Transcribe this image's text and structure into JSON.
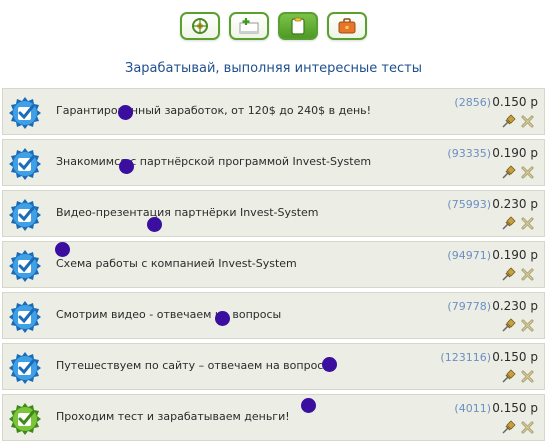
{
  "toolbar": {
    "buttons": [
      {
        "icon": "target-icon",
        "active": false
      },
      {
        "icon": "add-window-icon",
        "active": false
      },
      {
        "icon": "clipboard-icon",
        "active": true
      },
      {
        "icon": "briefcase-icon",
        "active": false
      }
    ]
  },
  "page_title": "Зарабатывай, выполняя интересные тесты",
  "colors": {
    "accent_green": "#5aa030",
    "title_blue": "#1f4f8f",
    "count_blue": "#6b8fc4",
    "row_bg": "#ecede4",
    "marker": "#3a0fa0"
  },
  "tasks": [
    {
      "title": "Гарантированный заработок, от 120$ до 240$ в день!",
      "count": "(2856)",
      "price": "0.150 р",
      "icon": "blue-checkbox-icon"
    },
    {
      "title": "Знакомимся с партнёрской программой Invest-System",
      "count": "(93335)",
      "price": "0.190 р",
      "icon": "blue-checkbox-icon"
    },
    {
      "title": "Видео-презентация партнёрки Invest-System",
      "count": "(75993)",
      "price": "0.230 р",
      "icon": "blue-checkbox-icon"
    },
    {
      "title": "Схема работы с компанией Invest-System",
      "count": "(94971)",
      "price": "0.190 р",
      "icon": "blue-checkbox-icon"
    },
    {
      "title": "Смотрим видео - отвечаем на вопросы",
      "count": "(79778)",
      "price": "0.230 р",
      "icon": "blue-checkbox-icon"
    },
    {
      "title": "Путешествуем по сайту – отвечаем на вопросы.",
      "count": "(123116)",
      "price": "0.150 р",
      "icon": "blue-checkbox-icon"
    },
    {
      "title": "Проходим тест и зарабатываем деньги!",
      "count": "(4011)",
      "price": "0.150 р",
      "icon": "green-checkbox-icon"
    }
  ]
}
